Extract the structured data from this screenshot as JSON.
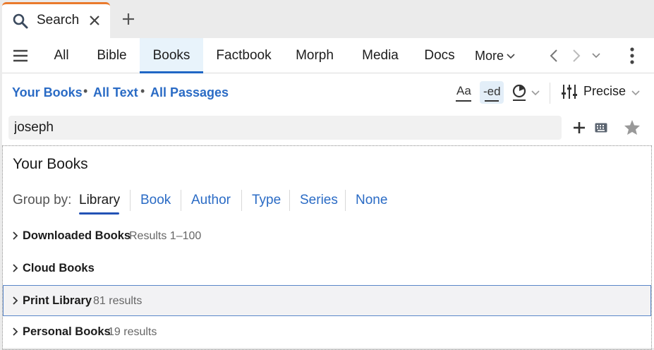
{
  "tab": {
    "title": "Search"
  },
  "nav": {
    "tabs": [
      {
        "label": "All"
      },
      {
        "label": "Bible"
      },
      {
        "label": "Books"
      },
      {
        "label": "Factbook"
      },
      {
        "label": "Morph"
      },
      {
        "label": "Media"
      },
      {
        "label": "Docs"
      }
    ],
    "active_tab": "Books",
    "more_label": "More"
  },
  "scope": {
    "items": [
      {
        "label": "Your Books"
      },
      {
        "label": "All Text"
      },
      {
        "label": "All Passages"
      }
    ],
    "separator": "•",
    "tools": {
      "case_label": "Aa",
      "stem_label": "-ed",
      "mode_label": "Precise"
    }
  },
  "search": {
    "value": "joseph",
    "placeholder": ""
  },
  "results": {
    "title": "Your Books",
    "group_by_label": "Group by:",
    "group_by_options": [
      {
        "label": "Library"
      },
      {
        "label": "Book"
      },
      {
        "label": "Author"
      },
      {
        "label": "Type"
      },
      {
        "label": "Series"
      },
      {
        "label": "None"
      }
    ],
    "active_group_by": "Library",
    "groups": [
      {
        "name": "Downloaded Books",
        "count": "Results 1–100",
        "selected": false
      },
      {
        "name": "Cloud Books",
        "count": "",
        "selected": false
      },
      {
        "name": "Print Library",
        "count": "81 results",
        "selected": true
      },
      {
        "name": "Personal Books",
        "count": "19 results",
        "selected": false
      }
    ]
  },
  "colors": {
    "accent": "#2a6bc5",
    "tab_highlight": "#ea7a2c",
    "active_tab_bg": "#e8f3fb"
  },
  "icons": [
    "search-icon",
    "close-icon",
    "plus-icon",
    "hamburger-icon",
    "chevron-down-icon",
    "chevron-left-icon",
    "chevron-right-icon",
    "kebab-icon",
    "history-icon",
    "sliders-icon",
    "keyboard-icon",
    "star-icon",
    "chevron-right-icon"
  ]
}
